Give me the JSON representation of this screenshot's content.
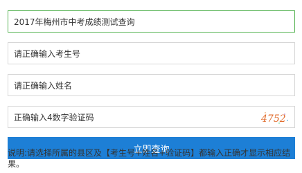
{
  "form": {
    "selected_option": "2017年梅州市中考成绩测试查询",
    "exam_number_placeholder": "请正确输入考生号",
    "name_placeholder": "请正确输入姓名",
    "captcha_placeholder": "正确输入4数字验证码",
    "captcha_code": "4752",
    "submit_label": "立即查询"
  },
  "note": {
    "text": "说明:请选择所属的县区及【考生号+姓名+验证码】都输入正确才显示相应结果。"
  },
  "colors": {
    "accent_button": "#1d7fd6",
    "select_border": "#55b352",
    "captcha_text": "#e06a2a"
  }
}
